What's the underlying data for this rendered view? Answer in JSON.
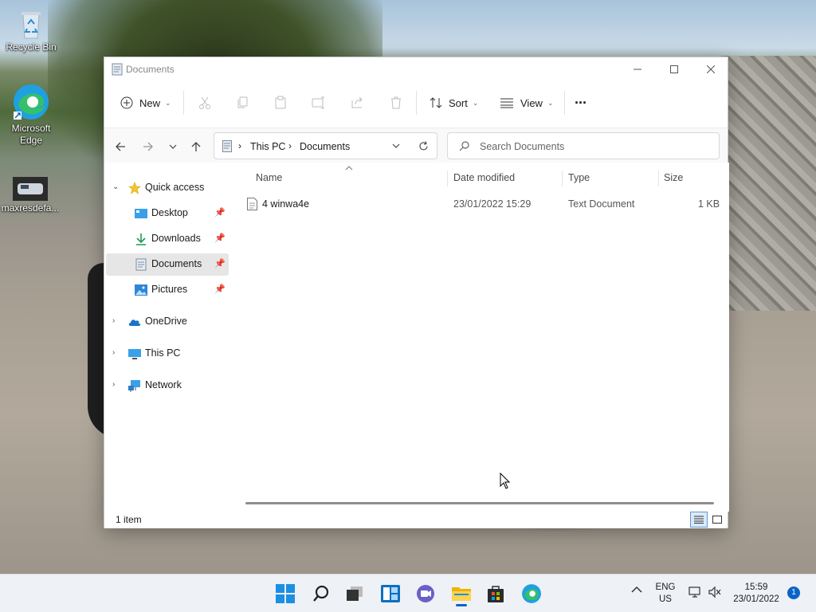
{
  "desktop": {
    "icons": [
      {
        "label": "Recycle Bin"
      },
      {
        "label": "Microsoft Edge"
      },
      {
        "label": "maxresdefa..."
      }
    ]
  },
  "window": {
    "title": "Documents",
    "toolbar": {
      "new_label": "New",
      "sort_label": "Sort",
      "view_label": "View",
      "more_label": "···"
    },
    "address": {
      "crumbs": [
        "This PC",
        "Documents"
      ]
    },
    "search": {
      "placeholder": "Search Documents"
    },
    "nav": {
      "quick_access": "Quick access",
      "items": [
        {
          "label": "Desktop",
          "pinned": true
        },
        {
          "label": "Downloads",
          "pinned": true
        },
        {
          "label": "Documents",
          "pinned": true,
          "selected": true
        },
        {
          "label": "Pictures",
          "pinned": true
        }
      ],
      "onedrive": "OneDrive",
      "thispc": "This PC",
      "network": "Network"
    },
    "columns": {
      "name": "Name",
      "date": "Date modified",
      "type": "Type",
      "size": "Size"
    },
    "files": [
      {
        "name": "4 winwa4e",
        "date": "23/01/2022 15:29",
        "type": "Text Document",
        "size": "1 KB"
      }
    ],
    "status": {
      "count": "1 item"
    }
  },
  "taskbar": {
    "lang": "ENG",
    "region": "US",
    "time": "15:59",
    "date": "23/01/2022",
    "notifications": "1"
  },
  "colors": {
    "accent": "#0a64c8",
    "selection": "#e6e6e6"
  }
}
